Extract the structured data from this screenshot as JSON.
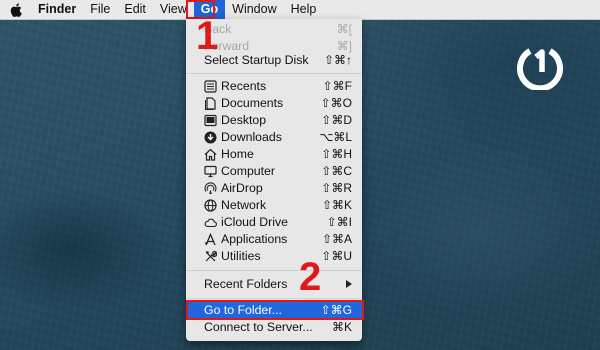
{
  "menubar": {
    "items": [
      "Finder",
      "File",
      "Edit",
      "View",
      "Go",
      "Window",
      "Help"
    ]
  },
  "go_menu": {
    "section1": [
      {
        "label": "Back",
        "shortcut": "⌘[",
        "disabled": true
      },
      {
        "label": "Forward",
        "shortcut": "⌘]",
        "disabled": true
      },
      {
        "label": "Select Startup Disk",
        "shortcut": "⇧⌘↑",
        "disabled": false
      }
    ],
    "places": [
      {
        "label": "Recents",
        "shortcut": "⇧⌘F",
        "icon": "recents-icon"
      },
      {
        "label": "Documents",
        "shortcut": "⇧⌘O",
        "icon": "documents-icon"
      },
      {
        "label": "Desktop",
        "shortcut": "⇧⌘D",
        "icon": "desktop-icon"
      },
      {
        "label": "Downloads",
        "shortcut": "⌥⌘L",
        "icon": "downloads-icon"
      },
      {
        "label": "Home",
        "shortcut": "⇧⌘H",
        "icon": "home-icon"
      },
      {
        "label": "Computer",
        "shortcut": "⇧⌘C",
        "icon": "computer-icon"
      },
      {
        "label": "AirDrop",
        "shortcut": "⇧⌘R",
        "icon": "airdrop-icon"
      },
      {
        "label": "Network",
        "shortcut": "⇧⌘K",
        "icon": "network-icon"
      },
      {
        "label": "iCloud Drive",
        "shortcut": "⇧⌘I",
        "icon": "icloud-icon"
      },
      {
        "label": "Applications",
        "shortcut": "⇧⌘A",
        "icon": "applications-icon"
      },
      {
        "label": "Utilities",
        "shortcut": "⇧⌘U",
        "icon": "utilities-icon"
      }
    ],
    "recent_folders": "Recent Folders",
    "go_to_folder": {
      "label": "Go to Folder...",
      "shortcut": "⇧⌘G"
    },
    "connect_to_server": {
      "label": "Connect to Server...",
      "shortcut": "⌘K"
    }
  },
  "annotations": {
    "step1": "1",
    "step2": "2"
  },
  "colors": {
    "highlight_box": "#e01818",
    "selection": "#2266dd",
    "menubar": "#e9e9ea"
  }
}
